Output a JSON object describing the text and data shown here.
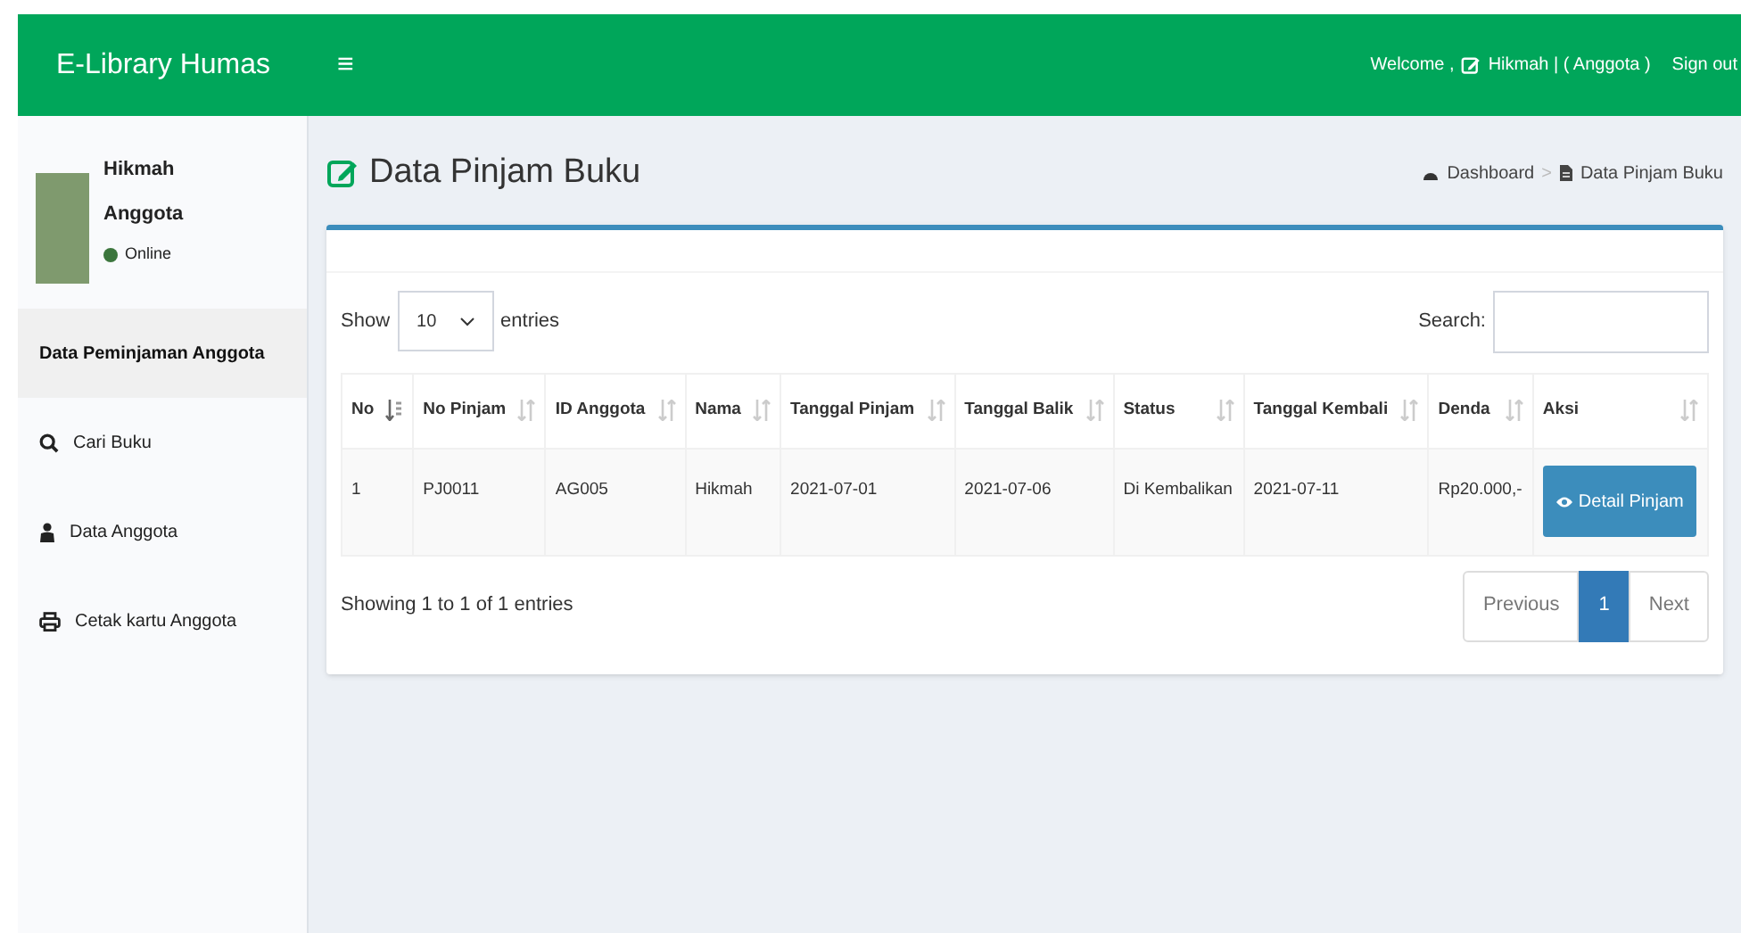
{
  "header": {
    "logo": "E-Library Humas",
    "menu_toggle": "≡",
    "welcome": "Welcome ,",
    "user": "Hikmah | ( Anggota )",
    "sign_out": "Sign out"
  },
  "sidebar": {
    "user": {
      "name": "Hikmah",
      "role": "Anggota",
      "status": "Online"
    },
    "items": [
      {
        "label": "Data Peminjaman Anggota",
        "kind": "plain",
        "selected": true
      },
      {
        "label": "Cari Buku",
        "kind": "search",
        "selected": false
      },
      {
        "label": "Data Anggota",
        "kind": "user",
        "selected": false
      },
      {
        "label": "Cetak kartu Anggota",
        "kind": "print",
        "selected": false
      }
    ]
  },
  "page": {
    "title": "Data Pinjam Buku",
    "breadcrumb": [
      "Dashboard",
      "Data Pinjam Buku"
    ],
    "breadcrumb_separator": ">"
  },
  "table_controls": {
    "show_label": "Show",
    "page_size": "10",
    "entries_label": "entries",
    "search_label": "Search:"
  },
  "table": {
    "columns": [
      {
        "label": "No",
        "sorted": true
      },
      {
        "label": "No Pinjam",
        "sorted": false
      },
      {
        "label": "ID Anggota",
        "sorted": false
      },
      {
        "label": "Nama",
        "sorted": false
      },
      {
        "label": "Tanggal Pinjam",
        "sorted": false
      },
      {
        "label": "Tanggal Balik",
        "sorted": false
      },
      {
        "label": "Status",
        "sorted": false
      },
      {
        "label": "Tanggal Kembali",
        "sorted": false
      },
      {
        "label": "Denda",
        "sorted": false
      },
      {
        "label": "Aksi",
        "sorted": false
      }
    ],
    "rows": [
      {
        "cells": [
          "1",
          "PJ0011",
          "AG005",
          "Hikmah",
          "2021-07-01",
          "2021-07-06",
          "Di Kembalikan",
          "2021-07-11",
          "Rp20.000,-"
        ],
        "action": "Detail Pinjam"
      }
    ]
  },
  "footer": {
    "info": "Showing 1 to 1 of 1 entries",
    "pagination": [
      {
        "label": "Previous",
        "selected": false
      },
      {
        "label": "1",
        "selected": true
      },
      {
        "label": "Next",
        "selected": false
      }
    ]
  }
}
